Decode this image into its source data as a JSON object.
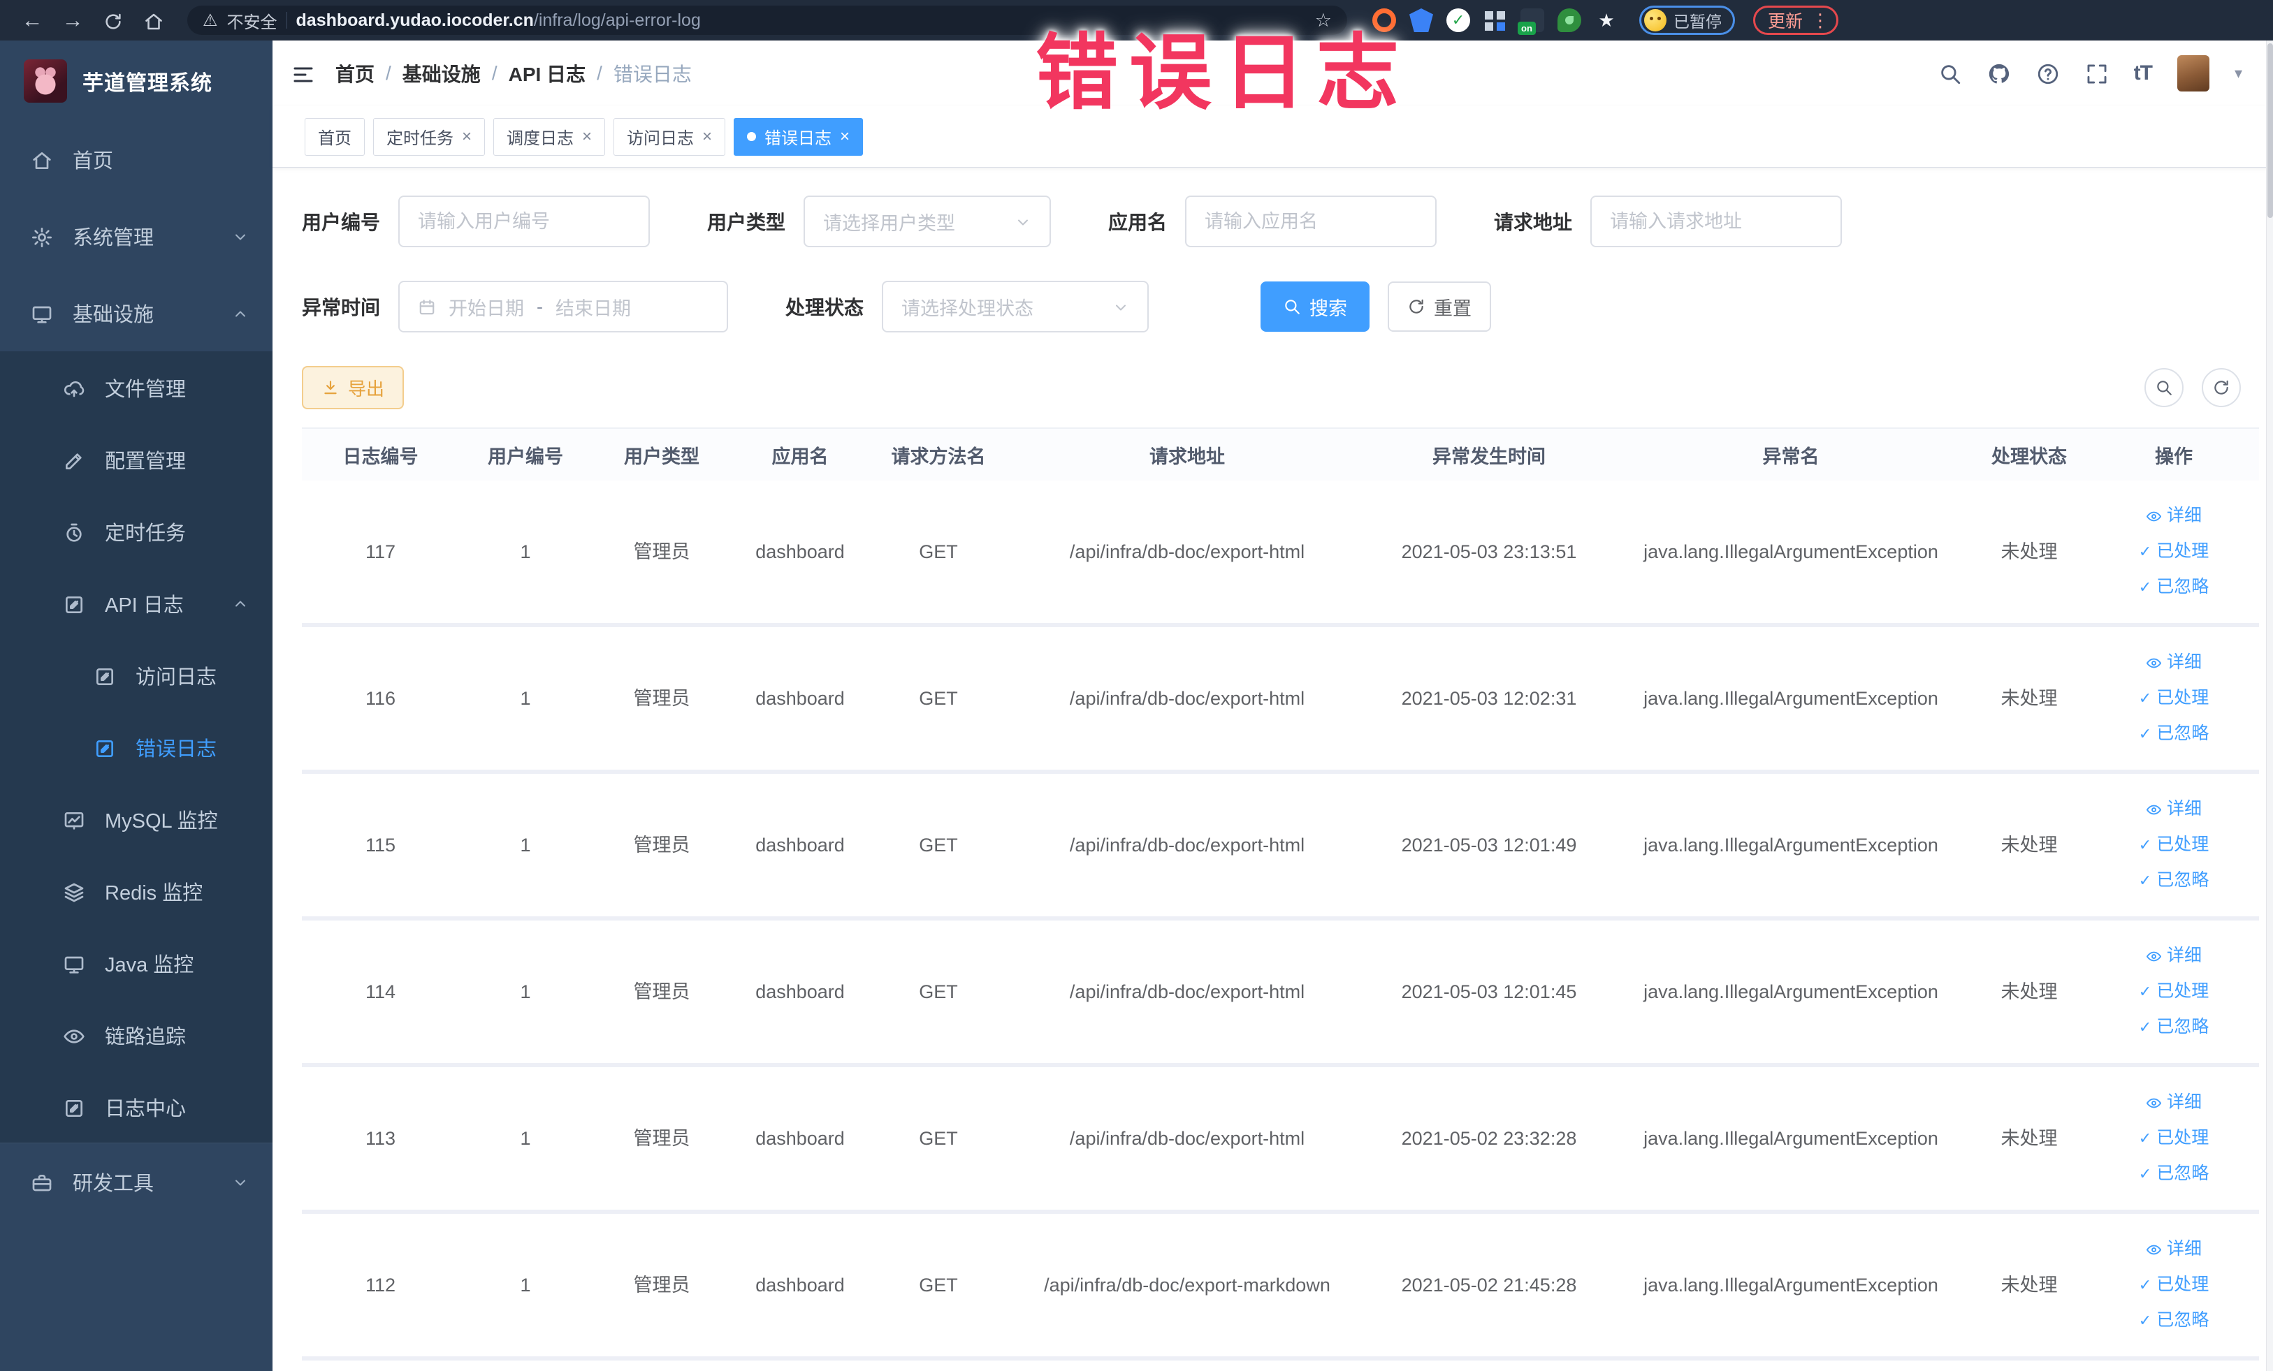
{
  "browser": {
    "security_label": "不安全",
    "url_host": "dashboard.yudao.iocoder.cn",
    "url_path": "/infra/log/api-error-log",
    "extension_on_badge": "on",
    "profile_status": "已暂停",
    "update_label": "更新"
  },
  "overlay": {
    "label": "错误日志",
    "color": "#f2365f"
  },
  "sidebar": {
    "title": "芋道管理系统",
    "items": [
      {
        "label": "首页",
        "icon": "home-icon"
      },
      {
        "label": "系统管理",
        "icon": "gear-icon"
      },
      {
        "label": "基础设施",
        "icon": "monitor-icon"
      },
      {
        "label": "文件管理",
        "icon": "cloud-upload-icon"
      },
      {
        "label": "配置管理",
        "icon": "edit-icon"
      },
      {
        "label": "定时任务",
        "icon": "timer-icon"
      },
      {
        "label": "API 日志",
        "icon": "log-icon"
      },
      {
        "label": "访问日志",
        "icon": "log-icon"
      },
      {
        "label": "错误日志",
        "icon": "log-icon"
      },
      {
        "label": "MySQL 监控",
        "icon": "chart-icon"
      },
      {
        "label": "Redis 监控",
        "icon": "layers-icon"
      },
      {
        "label": "Java 监控",
        "icon": "screen-icon"
      },
      {
        "label": "链路追踪",
        "icon": "eye-icon"
      },
      {
        "label": "日志中心",
        "icon": "log-icon"
      },
      {
        "label": "研发工具",
        "icon": "toolbox-icon"
      }
    ]
  },
  "header": {
    "breadcrumb": [
      "首页",
      "基础设施",
      "API 日志",
      "错误日志"
    ]
  },
  "tabs": [
    {
      "label": "首页"
    },
    {
      "label": "定时任务"
    },
    {
      "label": "调度日志"
    },
    {
      "label": "访问日志"
    },
    {
      "label": "错误日志"
    }
  ],
  "filters": {
    "user_id_label": "用户编号",
    "user_id_placeholder": "请输入用户编号",
    "user_type_label": "用户类型",
    "user_type_placeholder": "请选择用户类型",
    "app_name_label": "应用名",
    "app_name_placeholder": "请输入应用名",
    "request_url_label": "请求地址",
    "request_url_placeholder": "请输入请求地址",
    "time_label": "异常时间",
    "time_start_placeholder": "开始日期",
    "time_separator": "-",
    "time_end_placeholder": "结束日期",
    "status_label": "处理状态",
    "status_placeholder": "请选择处理状态",
    "search_label": "搜索",
    "reset_label": "重置"
  },
  "toolbar": {
    "export_label": "导出"
  },
  "table": {
    "columns": [
      "日志编号",
      "用户编号",
      "用户类型",
      "应用名",
      "请求方法名",
      "请求地址",
      "异常发生时间",
      "异常名",
      "处理状态",
      "操作"
    ],
    "action_labels": {
      "detail": "详细",
      "processed": "已处理",
      "ignored": "已忽略"
    },
    "rows": [
      {
        "log_id": "117",
        "user_id": "1",
        "user_type": "管理员",
        "app_name": "dashboard",
        "method": "GET",
        "url": "/api/infra/db-doc/export-html",
        "time": "2021-05-03 23:13:51",
        "exception": "java.lang.IllegalArgumentException",
        "status": "未处理"
      },
      {
        "log_id": "116",
        "user_id": "1",
        "user_type": "管理员",
        "app_name": "dashboard",
        "method": "GET",
        "url": "/api/infra/db-doc/export-html",
        "time": "2021-05-03 12:02:31",
        "exception": "java.lang.IllegalArgumentException",
        "status": "未处理"
      },
      {
        "log_id": "115",
        "user_id": "1",
        "user_type": "管理员",
        "app_name": "dashboard",
        "method": "GET",
        "url": "/api/infra/db-doc/export-html",
        "time": "2021-05-03 12:01:49",
        "exception": "java.lang.IllegalArgumentException",
        "status": "未处理"
      },
      {
        "log_id": "114",
        "user_id": "1",
        "user_type": "管理员",
        "app_name": "dashboard",
        "method": "GET",
        "url": "/api/infra/db-doc/export-html",
        "time": "2021-05-03 12:01:45",
        "exception": "java.lang.IllegalArgumentException",
        "status": "未处理"
      },
      {
        "log_id": "113",
        "user_id": "1",
        "user_type": "管理员",
        "app_name": "dashboard",
        "method": "GET",
        "url": "/api/infra/db-doc/export-html",
        "time": "2021-05-02 23:32:28",
        "exception": "java.lang.IllegalArgumentException",
        "status": "未处理"
      },
      {
        "log_id": "112",
        "user_id": "1",
        "user_type": "管理员",
        "app_name": "dashboard",
        "method": "GET",
        "url": "/api/infra/db-doc/export-markdown",
        "time": "2021-05-02 21:45:28",
        "exception": "java.lang.IllegalArgumentException",
        "status": "未处理"
      }
    ]
  },
  "colors": {
    "accent": "#409eff",
    "warning": "#e6a23c",
    "sidebar_bg": "#2f4560",
    "submenu_bg": "#25394f"
  }
}
